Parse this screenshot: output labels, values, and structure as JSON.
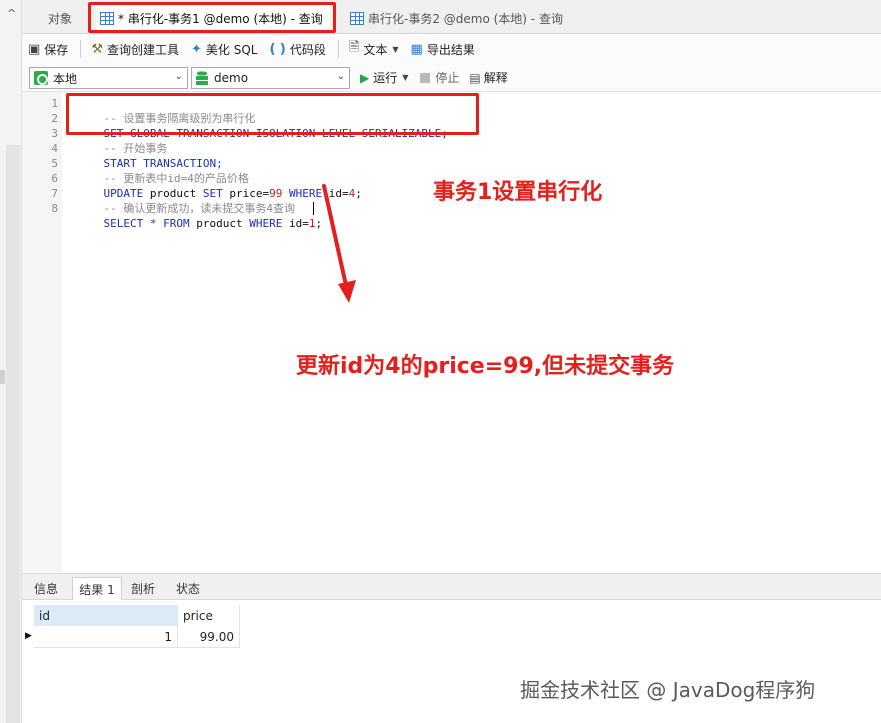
{
  "tabs": {
    "objects": "对象",
    "query1": "* 串行化-事务1 @demo (本地) - 查询",
    "query2": "串行化-事务2 @demo (本地) - 查询"
  },
  "toolbar": {
    "save": "保存",
    "query_builder": "查询创建工具",
    "beautify_sql": "美化 SQL",
    "code_snippet": "代码段",
    "text": "文本",
    "export_results": "导出结果"
  },
  "selectors": {
    "connection": "本地",
    "database": "demo",
    "run": "运行",
    "stop": "停止",
    "explain": "解释"
  },
  "editor": {
    "line_numbers": [
      "1",
      "2",
      "3",
      "4",
      "5",
      "6",
      "7",
      "8"
    ],
    "lines": [
      "-- 设置事务隔离级别为串行化",
      "SET GLOBAL TRANSACTION ISOLATION LEVEL SERIALIZABLE;",
      "-- 开始事务",
      "START TRANSACTION;",
      "-- 更新表中id=4的产品价格",
      "UPDATE product SET price=99 WHERE id=4;",
      "-- 确认更新成功，读未提交事务4查询",
      "SELECT * FROM product WHERE id=1;"
    ]
  },
  "annotations": {
    "note1": "事务1设置串行化",
    "note2": "更新id为4的price=99,但未提交事务"
  },
  "result_tabs": [
    "信息",
    "结果 1",
    "剖析",
    "状态"
  ],
  "result_grid": {
    "columns": [
      "id",
      "price"
    ],
    "rows": [
      [
        "1",
        "99.00"
      ]
    ]
  },
  "watermark": "掘金技术社区 @ JavaDog程序狗",
  "colors": {
    "annotation_red": "#e3201b",
    "keyword_blue": "#1a2fb5",
    "number_red": "#d21919",
    "comment_gray": "#8a8a8a"
  }
}
